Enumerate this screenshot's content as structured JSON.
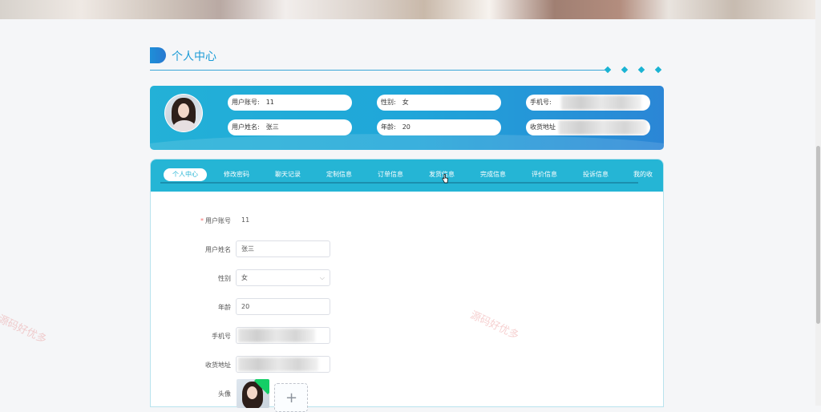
{
  "page": {
    "title": "个人中心"
  },
  "profile": {
    "items": [
      {
        "label": "用户账号:",
        "value": "11"
      },
      {
        "label": "性别:",
        "value": "女"
      },
      {
        "label": "手机号:",
        "value": ""
      },
      {
        "label": "用户姓名:",
        "value": "张三"
      },
      {
        "label": "年龄:",
        "value": "20"
      },
      {
        "label": "收货地址",
        "value": ""
      }
    ]
  },
  "tabs": [
    {
      "label": "个人中心",
      "active": true
    },
    {
      "label": "修改密码"
    },
    {
      "label": "聊天记录"
    },
    {
      "label": "定制信息"
    },
    {
      "label": "订单信息"
    },
    {
      "label": "发货信息"
    },
    {
      "label": "完成信息"
    },
    {
      "label": "评价信息"
    },
    {
      "label": "投诉信息"
    },
    {
      "label": "我的收"
    }
  ],
  "form": {
    "account": {
      "label": "用户账号",
      "value": "11"
    },
    "name": {
      "label": "用户姓名",
      "value": "张三"
    },
    "gender": {
      "label": "性别",
      "value": "女"
    },
    "age": {
      "label": "年龄",
      "value": "20"
    },
    "phone": {
      "label": "手机号",
      "value": ""
    },
    "address": {
      "label": "收货地址",
      "value": ""
    },
    "avatar": {
      "label": "头像"
    }
  },
  "watermark": "源码好优多",
  "colors": {
    "accent": "#25b5d5",
    "required": "#f56c6c",
    "upload_success": "#13ce66"
  },
  "icons": {
    "upload": "plus-icon",
    "select": "chevron-down-icon",
    "title": "title-marker-icon"
  }
}
